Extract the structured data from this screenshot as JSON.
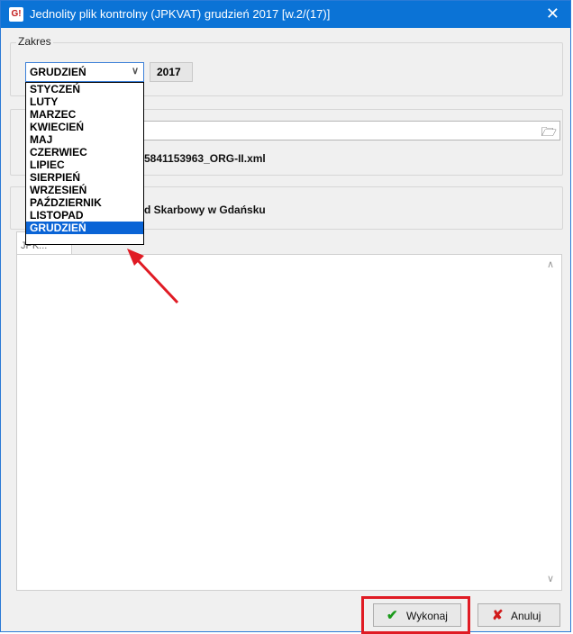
{
  "window": {
    "app_icon": "G!",
    "title": "Jednolity plik kontrolny (JPKVAT) grudzień 2017 [w.2/(17)]",
    "close_glyph": "✕"
  },
  "zakres": {
    "legend": "Zakres",
    "selected_month": "GRUDZIEŃ",
    "year": "2017",
    "months": [
      "STYCZEŃ",
      "LUTY",
      "MARZEC",
      "KWIECIEŃ",
      "MAJ",
      "CZERWIEC",
      "LIPIEC",
      "SIERPIEŃ",
      "WRZESIEŃ",
      "PAŹDZIERNIK",
      "LISTOPAD",
      "GRUDZIEŃ"
    ]
  },
  "file": {
    "path_value": "",
    "folder_icon": "folder-open-icon",
    "name_partial": "5841153963_ORG-II.xml"
  },
  "office": {
    "text_partial": "d Skarbowy w Gdańsku"
  },
  "tab": {
    "label_partial": "JPK..."
  },
  "buttons": {
    "execute": "Wykonaj",
    "cancel": "Anuluj"
  },
  "colors": {
    "titlebar": "#0b73d6",
    "selection": "#0a64d6",
    "highlight": "#e01b24"
  }
}
